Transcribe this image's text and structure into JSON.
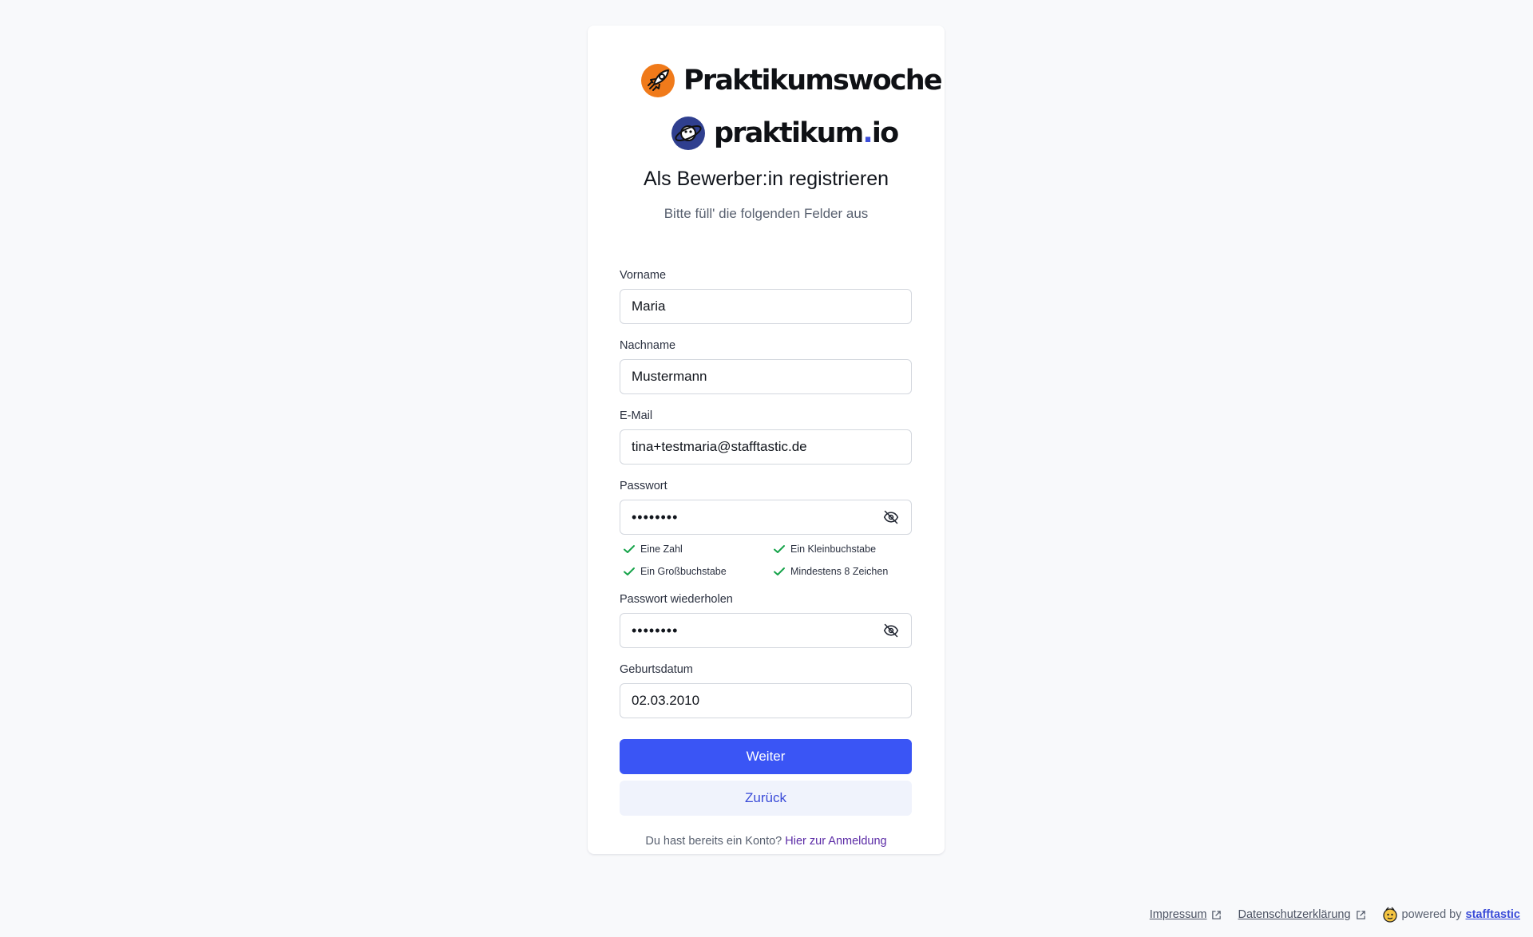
{
  "logos": {
    "primary": "Praktikumswoche",
    "secondary_name": "praktikum",
    "secondary_dot": ".",
    "secondary_tld": "io"
  },
  "header": {
    "title": "Als Bewerber:in registrieren",
    "subtitle": "Bitte füll' die folgenden Felder aus"
  },
  "form": {
    "firstname": {
      "label": "Vorname",
      "value": "Maria"
    },
    "lastname": {
      "label": "Nachname",
      "value": "Mustermann"
    },
    "email": {
      "label": "E-Mail",
      "value": "tina+testmaria@stafftastic.de"
    },
    "password": {
      "label": "Passwort",
      "value": "••••••••"
    },
    "password_repeat": {
      "label": "Passwort wiederholen",
      "value": "••••••••"
    },
    "birthdate": {
      "label": "Geburtsdatum",
      "value": "02.03.2010"
    },
    "requirements": [
      "Eine Zahl",
      "Ein Kleinbuchstabe",
      "Ein Großbuchstabe",
      "Mindestens 8 Zeichen"
    ],
    "submit_label": "Weiter",
    "back_label": "Zurück"
  },
  "login": {
    "prompt": "Du hast bereits ein Konto?",
    "link": "Hier zur Anmeldung"
  },
  "footer": {
    "impressum": "Impressum",
    "privacy": "Datenschutzerklärung",
    "powered_by": "powered by",
    "brand": "stafftastic"
  },
  "colors": {
    "primary_button": "#3a55f5",
    "check": "#16a34a",
    "logo_orange": "#f07a1a",
    "logo_navy": "#2f3f8f"
  }
}
